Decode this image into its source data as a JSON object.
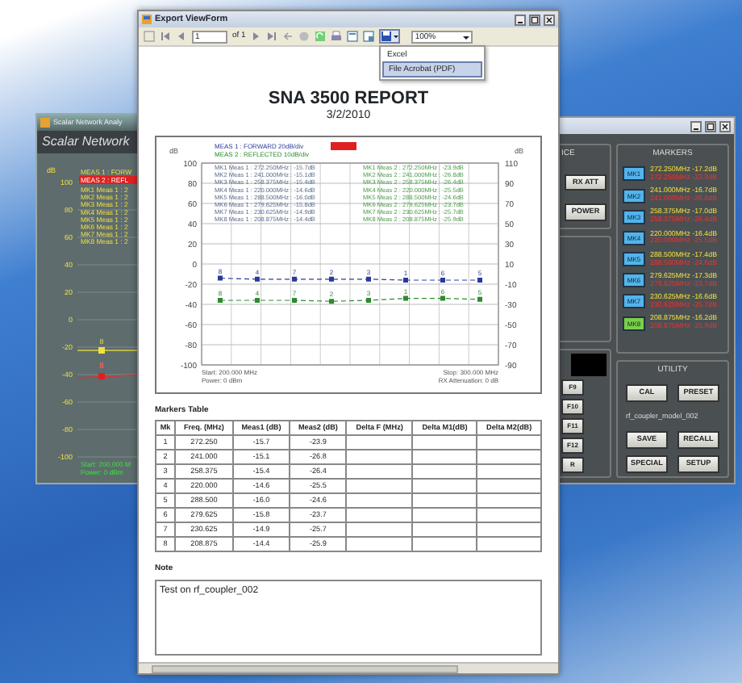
{
  "left_window": {
    "title": "Scalar Network Analy",
    "header": "Scalar Network",
    "unit": "dB",
    "yticks": [
      "100",
      "80",
      "60",
      "40",
      "20",
      "0",
      "-20",
      "-40",
      "-60",
      "-80",
      "-100"
    ],
    "legend": [
      {
        "text": "MEAS 1 : FORW",
        "highlighted": false
      },
      {
        "text": "MEAS 2 : REFL",
        "highlighted": true
      }
    ],
    "marker_lines": [
      "MK1 Meas 1 : 2",
      "MK2 Meas 1 : 2",
      "MK3 Meas 1 : 2",
      "MK4 Meas 1 : 2",
      "MK5 Meas 1 : 2",
      "MK6 Meas 1 : 2",
      "MK7 Meas 1 : 2",
      "MK8 Meas 1 : 2"
    ],
    "trace_labels": [
      "8",
      "8"
    ],
    "footer": [
      "Start: 200.000 M",
      "Power: 0 dBm"
    ]
  },
  "right_window": {
    "group_title": "ICE",
    "source_buttons": [
      "RX ATT",
      "POWER"
    ],
    "function_keys": [
      "F9",
      "F10",
      "F11",
      "F12",
      "R"
    ],
    "markers_title": "MARKERS",
    "markers": [
      {
        "label": "MK1",
        "selected": false,
        "reading1": "272.250MHz -17.2dB",
        "reading2": "272.250MHz -23.9dB"
      },
      {
        "label": "MK2",
        "selected": false,
        "reading1": "241.000MHz -16.7dB",
        "reading2": "241.000MHz -26.8dB"
      },
      {
        "label": "MK3",
        "selected": false,
        "reading1": "258.375MHz -17.0dB",
        "reading2": "258.375MHz -26.4dB"
      },
      {
        "label": "MK4",
        "selected": false,
        "reading1": "220.000MHz -16.4dB",
        "reading2": "220.000MHz -25.5dB"
      },
      {
        "label": "MK5",
        "selected": false,
        "reading1": "288.500MHz -17.4dB",
        "reading2": "288.500MHz -24.6dB"
      },
      {
        "label": "MK6",
        "selected": false,
        "reading1": "279.625MHz -17.3dB",
        "reading2": "279.625MHz -23.7dB"
      },
      {
        "label": "MK7",
        "selected": false,
        "reading1": "230.625MHz -16.6dB",
        "reading2": "230.625MHz -25.7dB"
      },
      {
        "label": "MK8",
        "selected": true,
        "reading1": "208.875MHz -16.2dB",
        "reading2": "208.875MHz -25.9dB"
      }
    ],
    "utility_title": "UTILITY",
    "utility_buttons": [
      "CAL",
      "PRESET"
    ],
    "file_name": "rf_coupler_model_002",
    "file_buttons": [
      "SAVE",
      "RECALL",
      "SPECIAL",
      "SETUP"
    ]
  },
  "export_window": {
    "title": "Export ViewForm",
    "toolbar": {
      "page": "1",
      "page_total": "of 1",
      "zoom": "100%"
    },
    "export_menu": [
      {
        "label": "Excel",
        "selected": false
      },
      {
        "label": "File Acrobat (PDF)",
        "selected": true
      }
    ],
    "report": {
      "title": "SNA 3500 REPORT",
      "date": "3/2/2010",
      "chart": {
        "unit_left": "dB",
        "unit_right": "dB",
        "meas1_readouts": [
          "MK1 Meas 1 : 272.250MHz : -15.7dB",
          "MK2 Meas 1 : 241.000MHz : -15.1dB",
          "MK3 Meas 1 : 258.375MHz : -15.4dB",
          "MK4 Meas 1 : 220.000MHz : -14.6dB",
          "MK5 Meas 1 : 288.500MHz : -16.0dB",
          "MK6 Meas 1 : 279.625MHz : -15.8dB",
          "MK7 Meas 1 : 230.625MHz : -14.9dB",
          "MK8 Meas 1 : 208.875MHz : -14.4dB"
        ],
        "meas2_readouts": [
          "MK1 Meas 2 : 272.250MHz : -23.9dB",
          "MK2 Meas 2 : 241.000MHz : -26.8dB",
          "MK3 Meas 2 : 258.375MHz : -26.4dB",
          "MK4 Meas 2 : 220.000MHz : -25.5dB",
          "MK5 Meas 2 : 288.500MHz : -24.6dB",
          "MK6 Meas 2 : 279.625MHz : -23.7dB",
          "MK7 Meas 2 : 230.625MHz : -25.7dB",
          "MK8 Meas 2 : 208.875MHz : -25.9dB"
        ],
        "meas1_point_labels": [
          "8",
          "4",
          "7",
          "2",
          "3",
          "1",
          "6",
          "5"
        ],
        "meas2_point_labels": [
          "8",
          "4",
          "7",
          "2",
          "3",
          "1",
          "6",
          "5"
        ],
        "footer_left": [
          "Start: 200.000 MHz",
          "Power: 0 dBm"
        ],
        "footer_right": [
          "Stop: 300.000 MHz",
          "RX Attenuation: 0 dB"
        ],
        "chart_data": {
          "type": "line",
          "grid": true,
          "categories": [
            null,
            null,
            null,
            null,
            null,
            null,
            null,
            null
          ],
          "ylim": [
            -100,
            100
          ],
          "y2lim": [
            -90,
            110
          ],
          "y2ticks": [
            {
              "value": -90,
              "label": "-90"
            },
            {
              "value": -70,
              "label": "-70"
            },
            {
              "value": -50,
              "label": "-50"
            },
            {
              "value": -30,
              "label": "-30"
            },
            {
              "value": -10,
              "label": "-10"
            },
            {
              "value": 10,
              "label": "10"
            },
            {
              "value": 30,
              "label": "30"
            },
            {
              "value": 50,
              "label": "50"
            },
            {
              "value": 70,
              "label": "70"
            },
            {
              "value": 90,
              "label": "90"
            },
            {
              "value": 110,
              "label": "110"
            }
          ],
          "yticks": [
            {
              "value": -100,
              "label": "-100"
            },
            {
              "value": -80,
              "label": "-80"
            },
            {
              "value": -60,
              "label": "-60"
            },
            {
              "value": -40,
              "label": "-40"
            },
            {
              "value": -20,
              "label": "-20"
            },
            {
              "value": 0,
              "label": "0"
            },
            {
              "value": 20,
              "label": "20"
            },
            {
              "value": 40,
              "label": "40"
            },
            {
              "value": 60,
              "label": "60"
            },
            {
              "value": 80,
              "label": "80"
            },
            {
              "value": 100,
              "label": "100"
            }
          ],
          "series": [
            {
              "name": "MEAS 1 : FORWARD 20dB/div",
              "color": "#2a3a9a",
              "line_style": "dashed",
              "marker": "square",
              "values": [
                -14,
                -15,
                -15,
                -15,
                -15,
                -16,
                -16,
                -16
              ]
            },
            {
              "name": "MEAS 2 : REFLECTED 10dB/div",
              "color": "#2e8a2e",
              "axis": "y2",
              "line_style": "dashed",
              "marker": "square",
              "values": [
                -26,
                -26,
                -26,
                -27,
                -26,
                -24,
                -24,
                -25
              ]
            }
          ]
        }
      },
      "markers_table": {
        "title": "Markers Table",
        "columns": [
          "Mk",
          "Freq. (MHz)",
          "Meas1 (dB)",
          "Meas2 (dB)",
          "Delta F (MHz)",
          "Delta M1(dB)",
          "Delta M2(dB)"
        ],
        "rows": [
          [
            "1",
            "272.250",
            "-15.7",
            "-23.9"
          ],
          [
            "2",
            "241.000",
            "-15.1",
            "-26.8"
          ],
          [
            "3",
            "258.375",
            "-15.4",
            "-26.4"
          ],
          [
            "4",
            "220.000",
            "-14.6",
            "-25.5"
          ],
          [
            "5",
            "288.500",
            "-16.0",
            "-24.6"
          ],
          [
            "6",
            "279.625",
            "-15.8",
            "-23.7"
          ],
          [
            "7",
            "230.625",
            "-14.9",
            "-25.7"
          ],
          [
            "8",
            "208.875",
            "-14.4",
            "-25.9"
          ]
        ]
      },
      "note": {
        "title": "Note",
        "text": "Test on rf_coupler_002"
      }
    }
  }
}
